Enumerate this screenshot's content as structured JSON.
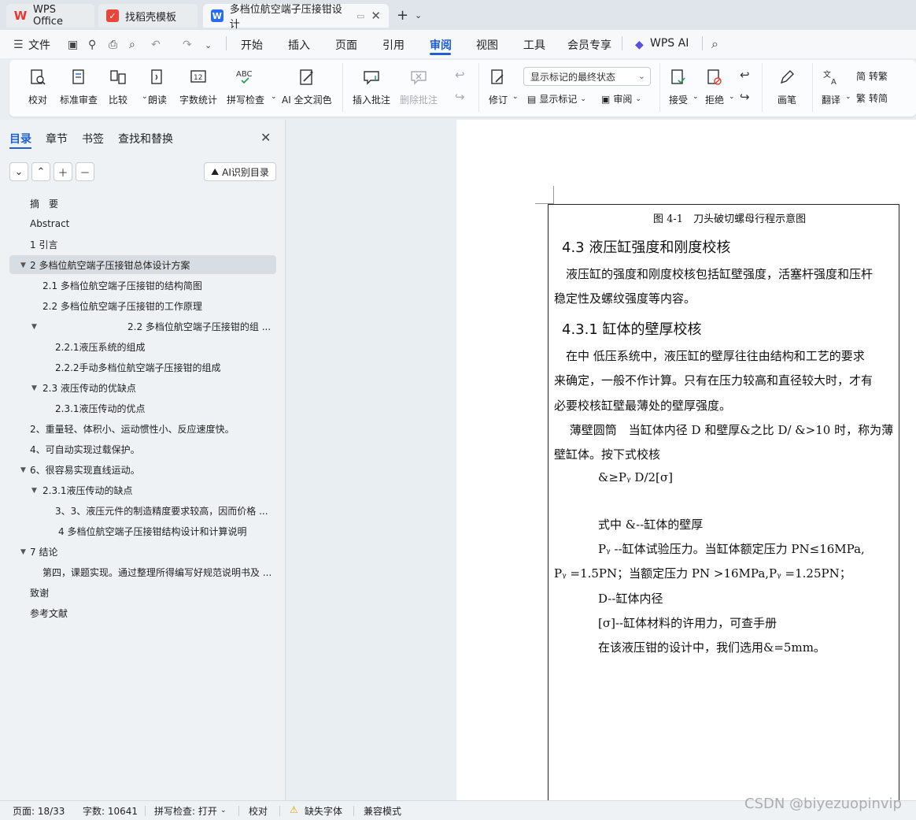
{
  "tabs": [
    {
      "label": "WPS Office"
    },
    {
      "label": "找稻壳模板"
    },
    {
      "label": "多档位航空端子压接钳设计"
    }
  ],
  "menu": {
    "file": "文件",
    "items": [
      "开始",
      "插入",
      "页面",
      "引用",
      "审阅",
      "视图",
      "工具",
      "会员专享"
    ],
    "active": "审阅",
    "wps_ai": "WPS AI"
  },
  "ribbon": {
    "proofread": "校对",
    "standard_review": "标准审查",
    "compare": "比较",
    "read_aloud": "朗读",
    "word_count": "字数统计",
    "spell_check": "拼写检查",
    "ai_polish": "AI 全文润色",
    "insert_comment": "插入批注",
    "delete_comment": "删除批注",
    "track": "修订",
    "markup_mode": "显示标记的最终状态",
    "show_markup": "显示标记",
    "review_pane": "审阅",
    "accept": "接受",
    "reject": "拒绝",
    "pen": "画笔",
    "translate": "翻译",
    "to_traditional": "转繁",
    "to_simplified": "转简"
  },
  "nav": {
    "tabs": [
      "目录",
      "章节",
      "书签",
      "查找和替换"
    ],
    "ai_toc": "AI识别目录",
    "toc": [
      "摘　要",
      "Abstract",
      "1 引言",
      "2 多档位航空端子压接钳总体设计方案",
      "2.1 多档位航空端子压接钳的结构简图",
      "2.2 多档位航空端子压接钳的工作原理",
      "2.2 多档位航空端子压接钳的组 ...",
      "2.2.1液压系统的组成",
      "2.2.2手动多档位航空端子压接钳的组成",
      "2.3 液压传动的优缺点",
      "2.3.1液压传动的优点",
      "2、重量轻、体积小、运动惯性小、反应速度快。",
      "4、可自动实现过载保护。",
      "6、很容易实现直线运动。",
      "2.3.1液压传动的缺点",
      "3、3、液压元件的制造精度要求较高，因而价格 ...",
      "4 多档位航空端子压接钳结构设计和计算说明",
      "7 结论",
      "第四，课题实现。通过整理所得编写好规范说明书及 ...",
      "致谢",
      "参考文献"
    ]
  },
  "document": {
    "caption": "图 4-1　刀头破切螺母行程示意图",
    "h1": "4.3 液压缸强度和刚度校核",
    "p1a": "　液压缸的强度和刚度校核包括缸壁强度，活塞杆强度和压杆",
    "p1b": "稳定性及螺纹强度等内容。",
    "h2": "4.3.1 缸体的壁厚校核",
    "p2a": "　在中 低压系统中，液压缸的壁厚往往由结构和工艺的要求",
    "p2b": "来确定，一般不作计算。只有在压力较高和直径较大时，才有",
    "p2c": "必要校核缸壁最薄处的壁厚强度。",
    "p3a": "　 薄壁圆筒　当缸体内径 D 和壁厚&之比 D/ &>10 时，称为薄",
    "p3b": "壁缸体。按下式校核",
    "formula": "&≥Pᵧ D/2[σ]",
    "where1": "式中 &--缸体的壁厚",
    "where2": "Pᵧ --缸体试验压力。当缸体额定压力 PN≤16MPa,",
    "where3": "Pᵧ =1.5PN；当额定压力 PN >16MPa,Pᵧ =1.25PN；",
    "where4": "D--缸体内径",
    "where5": "[σ]--缸体材料的许用力，可查手册",
    "where6": "在该液压钳的设计中，我们选用&=5mm。"
  },
  "status": {
    "page": "页面: 18/33",
    "words": "字数: 10641",
    "spell": "拼写检查: 打开",
    "proof": "校对",
    "missing_font": "缺失字体",
    "compat": "兼容模式"
  },
  "watermark": "CSDN @biyezuopinvip",
  "colors": {
    "accent": "#1f5fd1",
    "wps_red": "#e33b2e"
  }
}
